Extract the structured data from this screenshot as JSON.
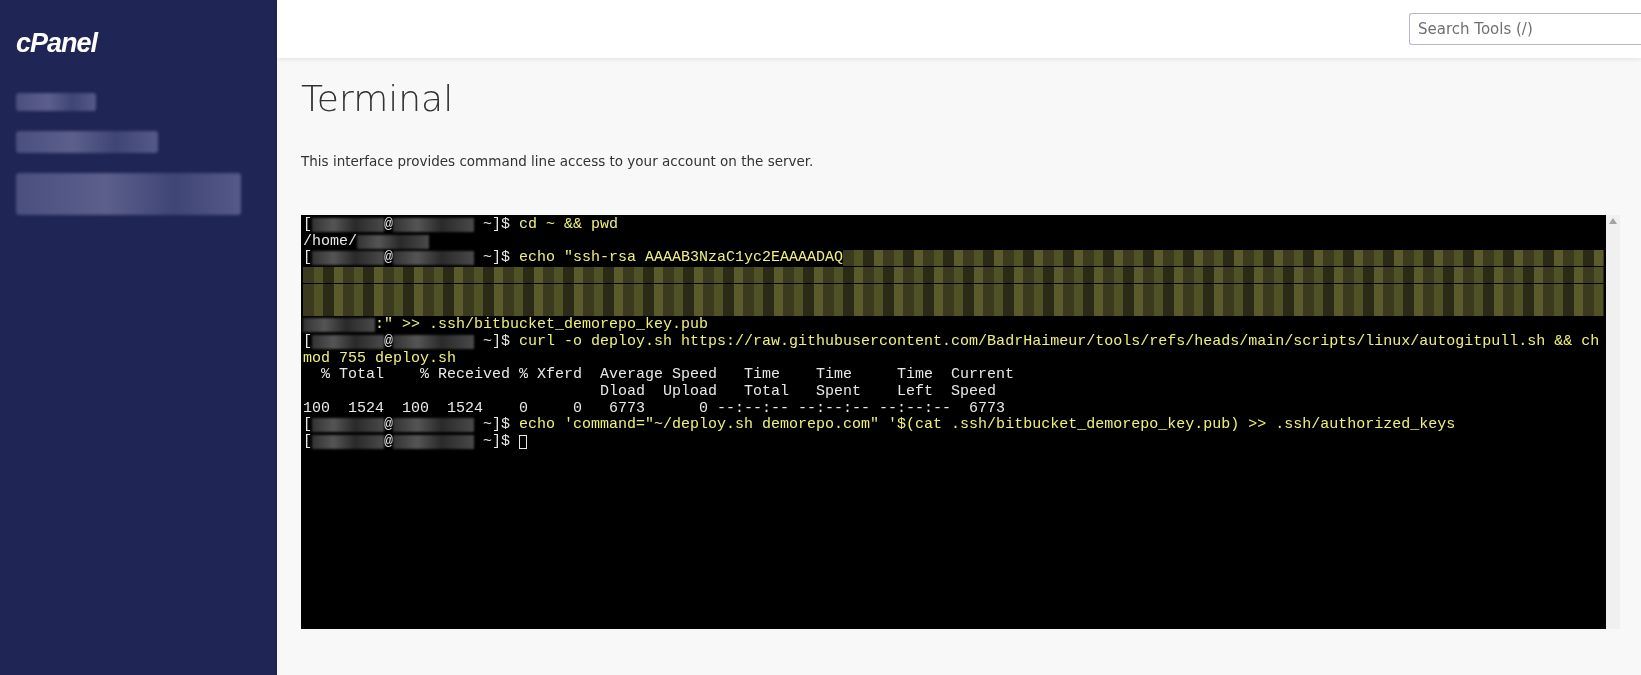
{
  "sidebar": {
    "logo": "cPanel"
  },
  "header": {
    "search": {
      "placeholder": "Search Tools (/)"
    }
  },
  "page": {
    "title": "Terminal",
    "description": "This interface provides command line access to your account on the server."
  },
  "terminal": {
    "lines": [
      {
        "segments": [
          {
            "kind": "prompt",
            "text": "["
          },
          {
            "kind": "redacted-name"
          },
          {
            "kind": "prompt",
            "text": "@"
          },
          {
            "kind": "redacted-host"
          },
          {
            "kind": "prompt",
            "text": " ~]$ "
          },
          {
            "kind": "command",
            "text": "cd ~ && pwd"
          }
        ]
      },
      {
        "segments": [
          {
            "kind": "output",
            "text": "/home/"
          },
          {
            "kind": "redacted-name"
          }
        ]
      },
      {
        "segments": [
          {
            "kind": "prompt",
            "text": "["
          },
          {
            "kind": "redacted-name"
          },
          {
            "kind": "prompt",
            "text": "@"
          },
          {
            "kind": "redacted-host"
          },
          {
            "kind": "prompt",
            "text": " ~]$ "
          },
          {
            "kind": "command",
            "text": "echo \"ssh-rsa AAAAB3NzaC1yc2EAAAADAQ"
          },
          {
            "kind": "redacted-key"
          }
        ]
      },
      {
        "segments": [
          {
            "kind": "redacted-key"
          }
        ]
      },
      {
        "segments": [
          {
            "kind": "redacted-key"
          }
        ]
      },
      {
        "segments": [
          {
            "kind": "redacted-key"
          }
        ]
      },
      {
        "segments": [
          {
            "kind": "redacted-name"
          },
          {
            "kind": "command",
            "text": ":\" >> .ssh/bitbucket_demorepo_key.pub"
          }
        ]
      },
      {
        "segments": [
          {
            "kind": "prompt",
            "text": "["
          },
          {
            "kind": "redacted-name"
          },
          {
            "kind": "prompt",
            "text": "@"
          },
          {
            "kind": "redacted-host"
          },
          {
            "kind": "prompt",
            "text": " ~]$ "
          },
          {
            "kind": "command",
            "text": "curl -o deploy.sh https://raw.githubusercontent.com/BadrHaimeur/tools/refs/heads/main/scripts/linux/autogitpull.sh && ch"
          }
        ]
      },
      {
        "segments": [
          {
            "kind": "command",
            "text": "mod 755 deploy.sh"
          }
        ]
      },
      {
        "segments": [
          {
            "kind": "output",
            "text": "  % Total    % Received % Xferd  Average Speed   Time    Time     Time  Current"
          }
        ]
      },
      {
        "segments": [
          {
            "kind": "output",
            "text": "                                 Dload  Upload   Total   Spent    Left  Speed"
          }
        ]
      },
      {
        "segments": [
          {
            "kind": "output",
            "text": "100  1524  100  1524    0     0   6773      0 --:--:-- --:--:-- --:--:--  6773"
          }
        ]
      },
      {
        "segments": [
          {
            "kind": "prompt",
            "text": "["
          },
          {
            "kind": "redacted-name"
          },
          {
            "kind": "prompt",
            "text": "@"
          },
          {
            "kind": "redacted-host"
          },
          {
            "kind": "prompt",
            "text": " ~]$ "
          },
          {
            "kind": "command",
            "text": "echo 'command=\"~/deploy.sh demorepo.com\" '$(cat .ssh/bitbucket_demorepo_key.pub) >> .ssh/authorized_keys"
          }
        ]
      },
      {
        "segments": [
          {
            "kind": "prompt",
            "text": "["
          },
          {
            "kind": "redacted-name"
          },
          {
            "kind": "prompt",
            "text": "@"
          },
          {
            "kind": "redacted-host"
          },
          {
            "kind": "prompt",
            "text": " ~]$ "
          },
          {
            "kind": "cursor"
          }
        ]
      }
    ]
  }
}
